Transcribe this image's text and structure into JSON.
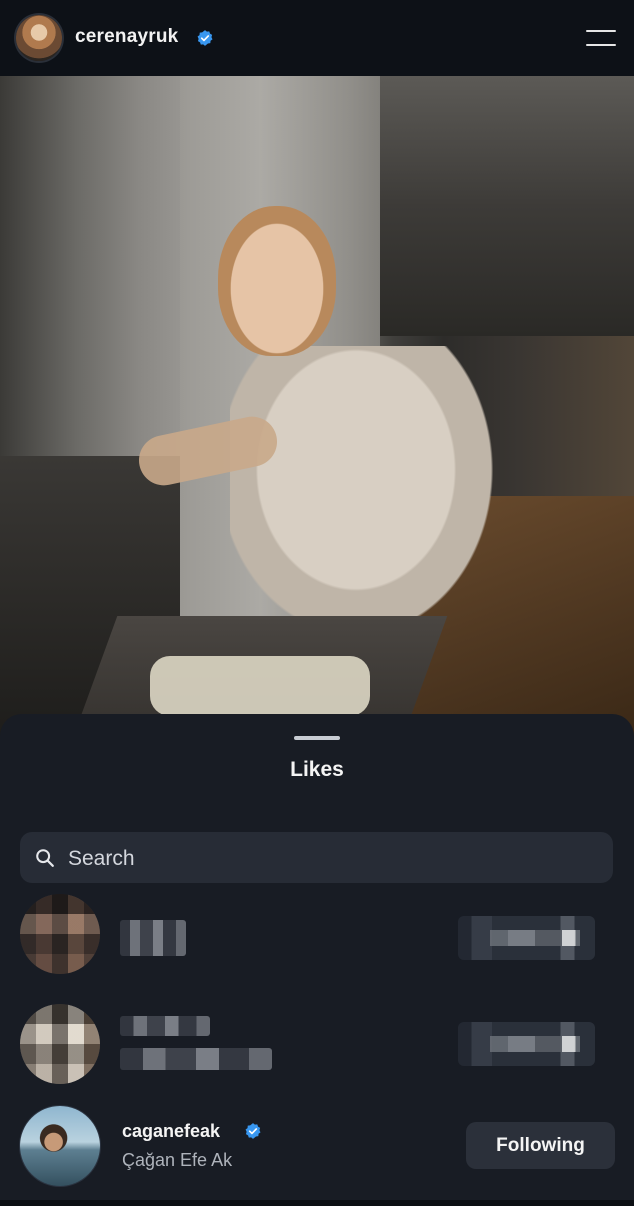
{
  "header": {
    "username": "cerenayruk",
    "verified": true,
    "menu_icon": "hamburger-menu-icon"
  },
  "post": {
    "image_subject": "photo"
  },
  "likes_sheet": {
    "title": "Likes",
    "search": {
      "placeholder": "Search",
      "value": ""
    },
    "rows": [
      {
        "username": "",
        "full_name": "",
        "obscured": true,
        "button": ""
      },
      {
        "username": "",
        "full_name": "",
        "obscured": true,
        "button": ""
      },
      {
        "username": "caganefeak",
        "full_name": "Çağan Efe Ak",
        "verified": true,
        "button": "Following"
      }
    ]
  },
  "colors": {
    "accent_verified": "#3897f0",
    "sheet_bg": "#181c24",
    "topbar_bg": "#0d1117"
  }
}
